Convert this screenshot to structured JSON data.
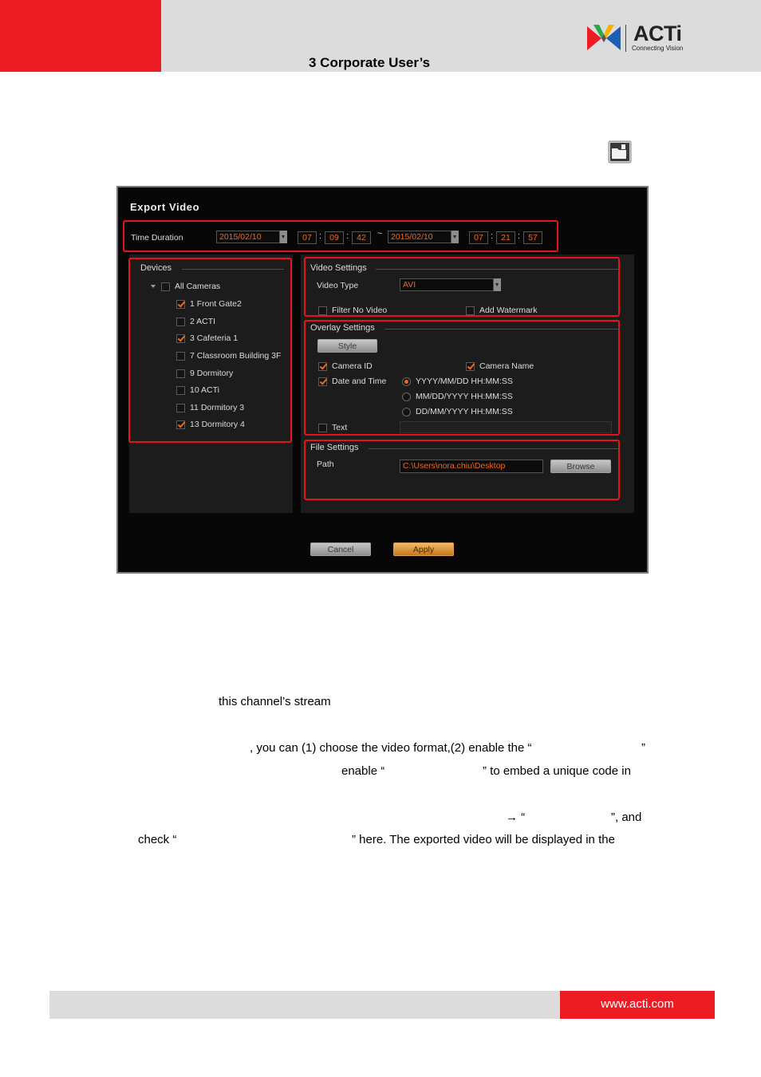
{
  "header": {
    "title": "3 Corporate User’s",
    "logo_text": "ACTi",
    "logo_tagline": "Connecting Vision"
  },
  "dialog": {
    "title": "Export Video",
    "time_duration_label": "Time Duration",
    "start_date": "2015/02/10",
    "start_hour": "07",
    "start_minute": "09",
    "start_second": "42",
    "range_separator": "~",
    "end_date": "2015/02/10",
    "end_hour": "07",
    "end_minute": "21",
    "end_second": "57",
    "devices": {
      "title": "Devices",
      "all_label": "All Cameras",
      "all_checked": false,
      "items": [
        {
          "label": "1 Front Gate2",
          "checked": true
        },
        {
          "label": "2 ACTI",
          "checked": false
        },
        {
          "label": "3 Cafeteria 1",
          "checked": true
        },
        {
          "label": "7 Classroom Building 3F",
          "checked": false
        },
        {
          "label": "9 Dormitory",
          "checked": false
        },
        {
          "label": "10 ACTi",
          "checked": false
        },
        {
          "label": "11 Dormitory 3",
          "checked": false
        },
        {
          "label": "13 Dormitory 4",
          "checked": true
        }
      ]
    },
    "video_settings": {
      "title": "Video Settings",
      "type_label": "Video Type",
      "type_value": "AVI",
      "filter_no_video": "Filter No Video",
      "filter_no_video_checked": false,
      "add_watermark": "Add Watermark",
      "add_watermark_checked": false
    },
    "overlay_settings": {
      "title": "Overlay Settings",
      "style_button": "Style",
      "camera_id": "Camera ID",
      "camera_id_checked": true,
      "camera_name": "Camera Name",
      "camera_name_checked": true,
      "date_time": "Date and Time",
      "date_time_checked": true,
      "formats": [
        {
          "label": "YYYY/MM/DD HH:MM:SS",
          "selected": true
        },
        {
          "label": "MM/DD/YYYY HH:MM:SS",
          "selected": false
        },
        {
          "label": "DD/MM/YYYY HH:MM:SS",
          "selected": false
        }
      ],
      "text_label": "Text",
      "text_checked": false,
      "text_value": ""
    },
    "file_settings": {
      "title": "File Settings",
      "path_label": "Path",
      "path_value": "C:\\Users\\nora.chiu\\Desktop",
      "browse_button": "Browse"
    },
    "cancel_button": "Cancel",
    "apply_button": "Apply"
  },
  "body_text": {
    "line_stream": "this channel’s stream",
    "line_format": ", you can (1) choose the video format,(2) enable the “",
    "line_format_end": "”",
    "line_watermark_a": "enable “",
    "line_watermark_b": "” to embed a unique code in",
    "line_arrow": "→ “",
    "line_arrow_end": "”, and",
    "line_check": "check “",
    "line_check_end": "” here. The exported video will be displayed in the"
  },
  "footer": {
    "url": "www.acti.com"
  },
  "colors": {
    "brand_red": "#ed1c24",
    "accent_orange": "#ee6a1c",
    "highlight_red": "#e5141c"
  }
}
